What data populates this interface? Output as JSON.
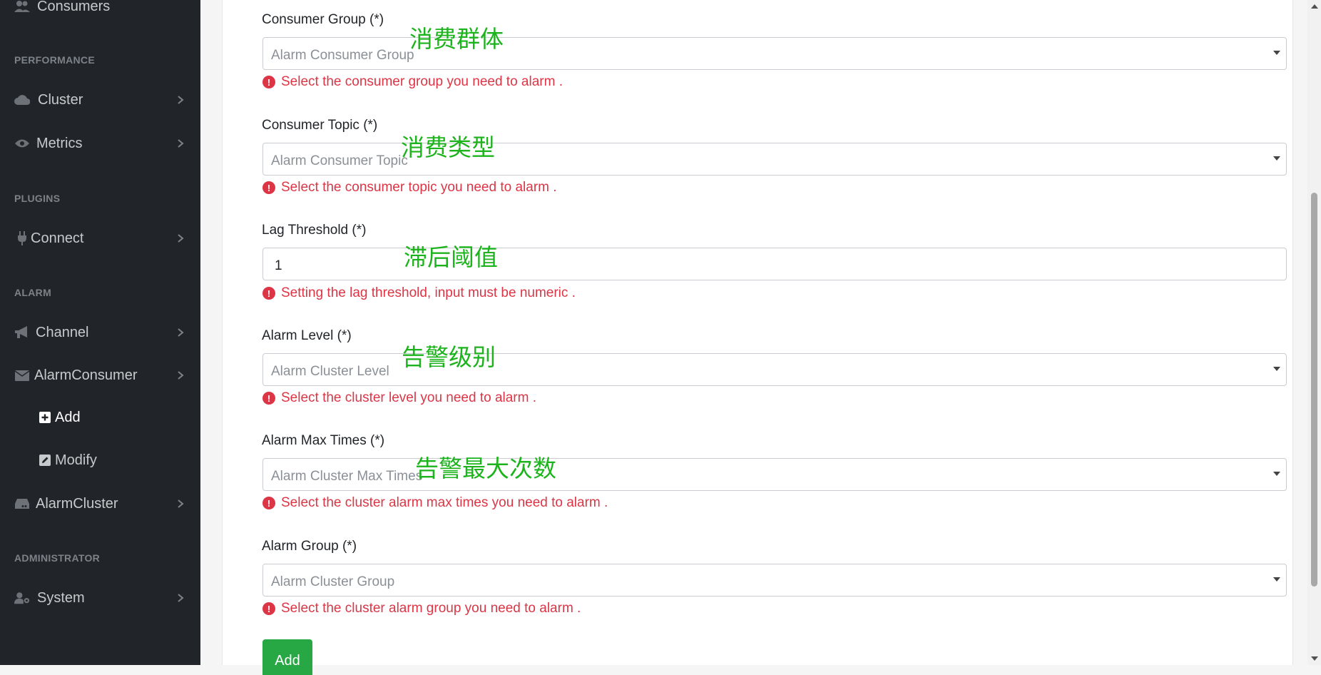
{
  "sidebar": {
    "partial_item": "Consumers",
    "sections": {
      "performance": "PERFORMANCE",
      "plugins": "PLUGINS",
      "alarm": "ALARM",
      "administrator": "ADMINISTRATOR"
    },
    "items": {
      "cluster": "Cluster",
      "metrics": "Metrics",
      "connect": "Connect",
      "channel": "Channel",
      "alarm_consumer": "AlarmConsumer",
      "add": "Add",
      "modify": "Modify",
      "alarm_cluster": "AlarmCluster",
      "system": "System"
    }
  },
  "form": {
    "consumer_group": {
      "label": "Consumer Group (*)",
      "placeholder": "Alarm Consumer Group",
      "error": "Select the consumer group you need to alarm .",
      "annotation": "消费群体"
    },
    "consumer_topic": {
      "label": "Consumer Topic (*)",
      "placeholder": "Alarm Consumer Topic",
      "error": "Select the consumer topic you need to alarm .",
      "annotation": "消费类型"
    },
    "lag_threshold": {
      "label": "Lag Threshold (*)",
      "value": "1",
      "error": "Setting the lag threshold, input must be numeric .",
      "annotation": "滞后阈值"
    },
    "alarm_level": {
      "label": "Alarm Level (*)",
      "placeholder": "Alarm Cluster Level",
      "error": "Select the cluster level you need to alarm .",
      "annotation": "告警级别"
    },
    "alarm_max_times": {
      "label": "Alarm Max Times (*)",
      "placeholder": "Alarm Cluster Max Times",
      "error": "Select the cluster alarm max times you need to alarm .",
      "annotation": "告警最大次数"
    },
    "alarm_group": {
      "label": "Alarm Group (*)",
      "placeholder": "Alarm Cluster Group",
      "error": "Select the cluster alarm group you need to alarm ."
    },
    "submit_label": "Add"
  },
  "colors": {
    "sidebar_bg": "#212529",
    "error": "#dc3545",
    "annotation": "#1db31d",
    "button": "#28a745"
  }
}
